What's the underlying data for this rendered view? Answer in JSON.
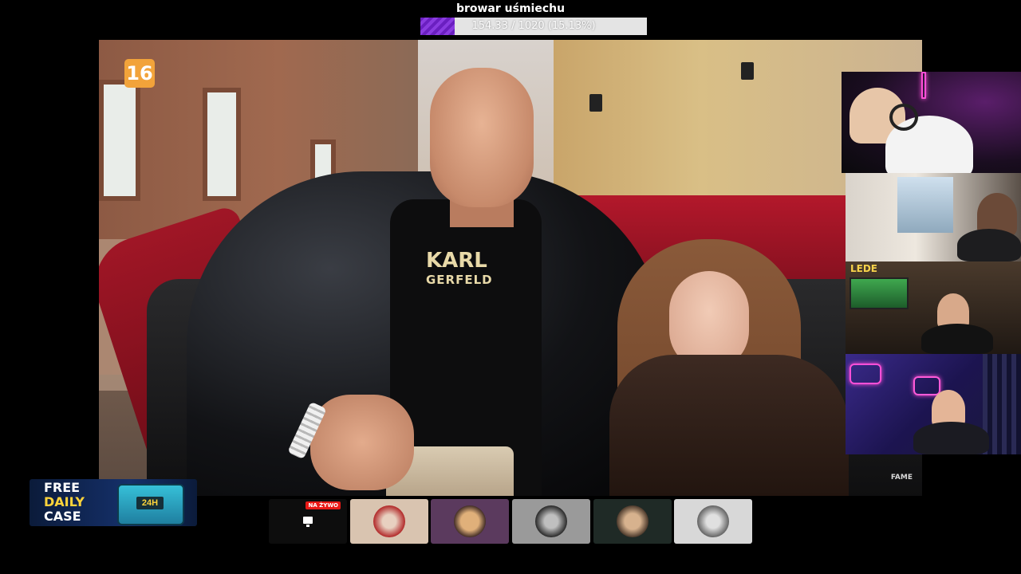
{
  "goal": {
    "title": "browar uśmiechu",
    "progress_text": "154.33 / 1020 (15.13%)",
    "current": 154.33,
    "target": 1020,
    "progress_fraction": 0.1513,
    "fill_color": "#7a2ed6"
  },
  "main_video": {
    "age_rating": "16",
    "shirt_line1": "KARL",
    "shirt_line2": "GERFELD",
    "watermark": "FAME"
  },
  "webcams": {
    "cam3_overlay_text": "LEDE"
  },
  "ad": {
    "line1": "FREE",
    "line2": "DAILY",
    "line3": "CASE",
    "chest_label": "24H"
  },
  "bottom_strip": {
    "live_badge": "NA ŻYWO",
    "tiles": [
      {
        "name": "live-monitor",
        "bg": "#0d0d0d"
      },
      {
        "name": "avatar-1",
        "bg": "#d9c4b0"
      },
      {
        "name": "avatar-2",
        "bg": "#5b3a5e"
      },
      {
        "name": "avatar-3",
        "bg": "#9a9a9a"
      },
      {
        "name": "avatar-4",
        "bg": "#1f2a26"
      },
      {
        "name": "avatar-5",
        "bg": "#d8d8d8"
      }
    ]
  }
}
